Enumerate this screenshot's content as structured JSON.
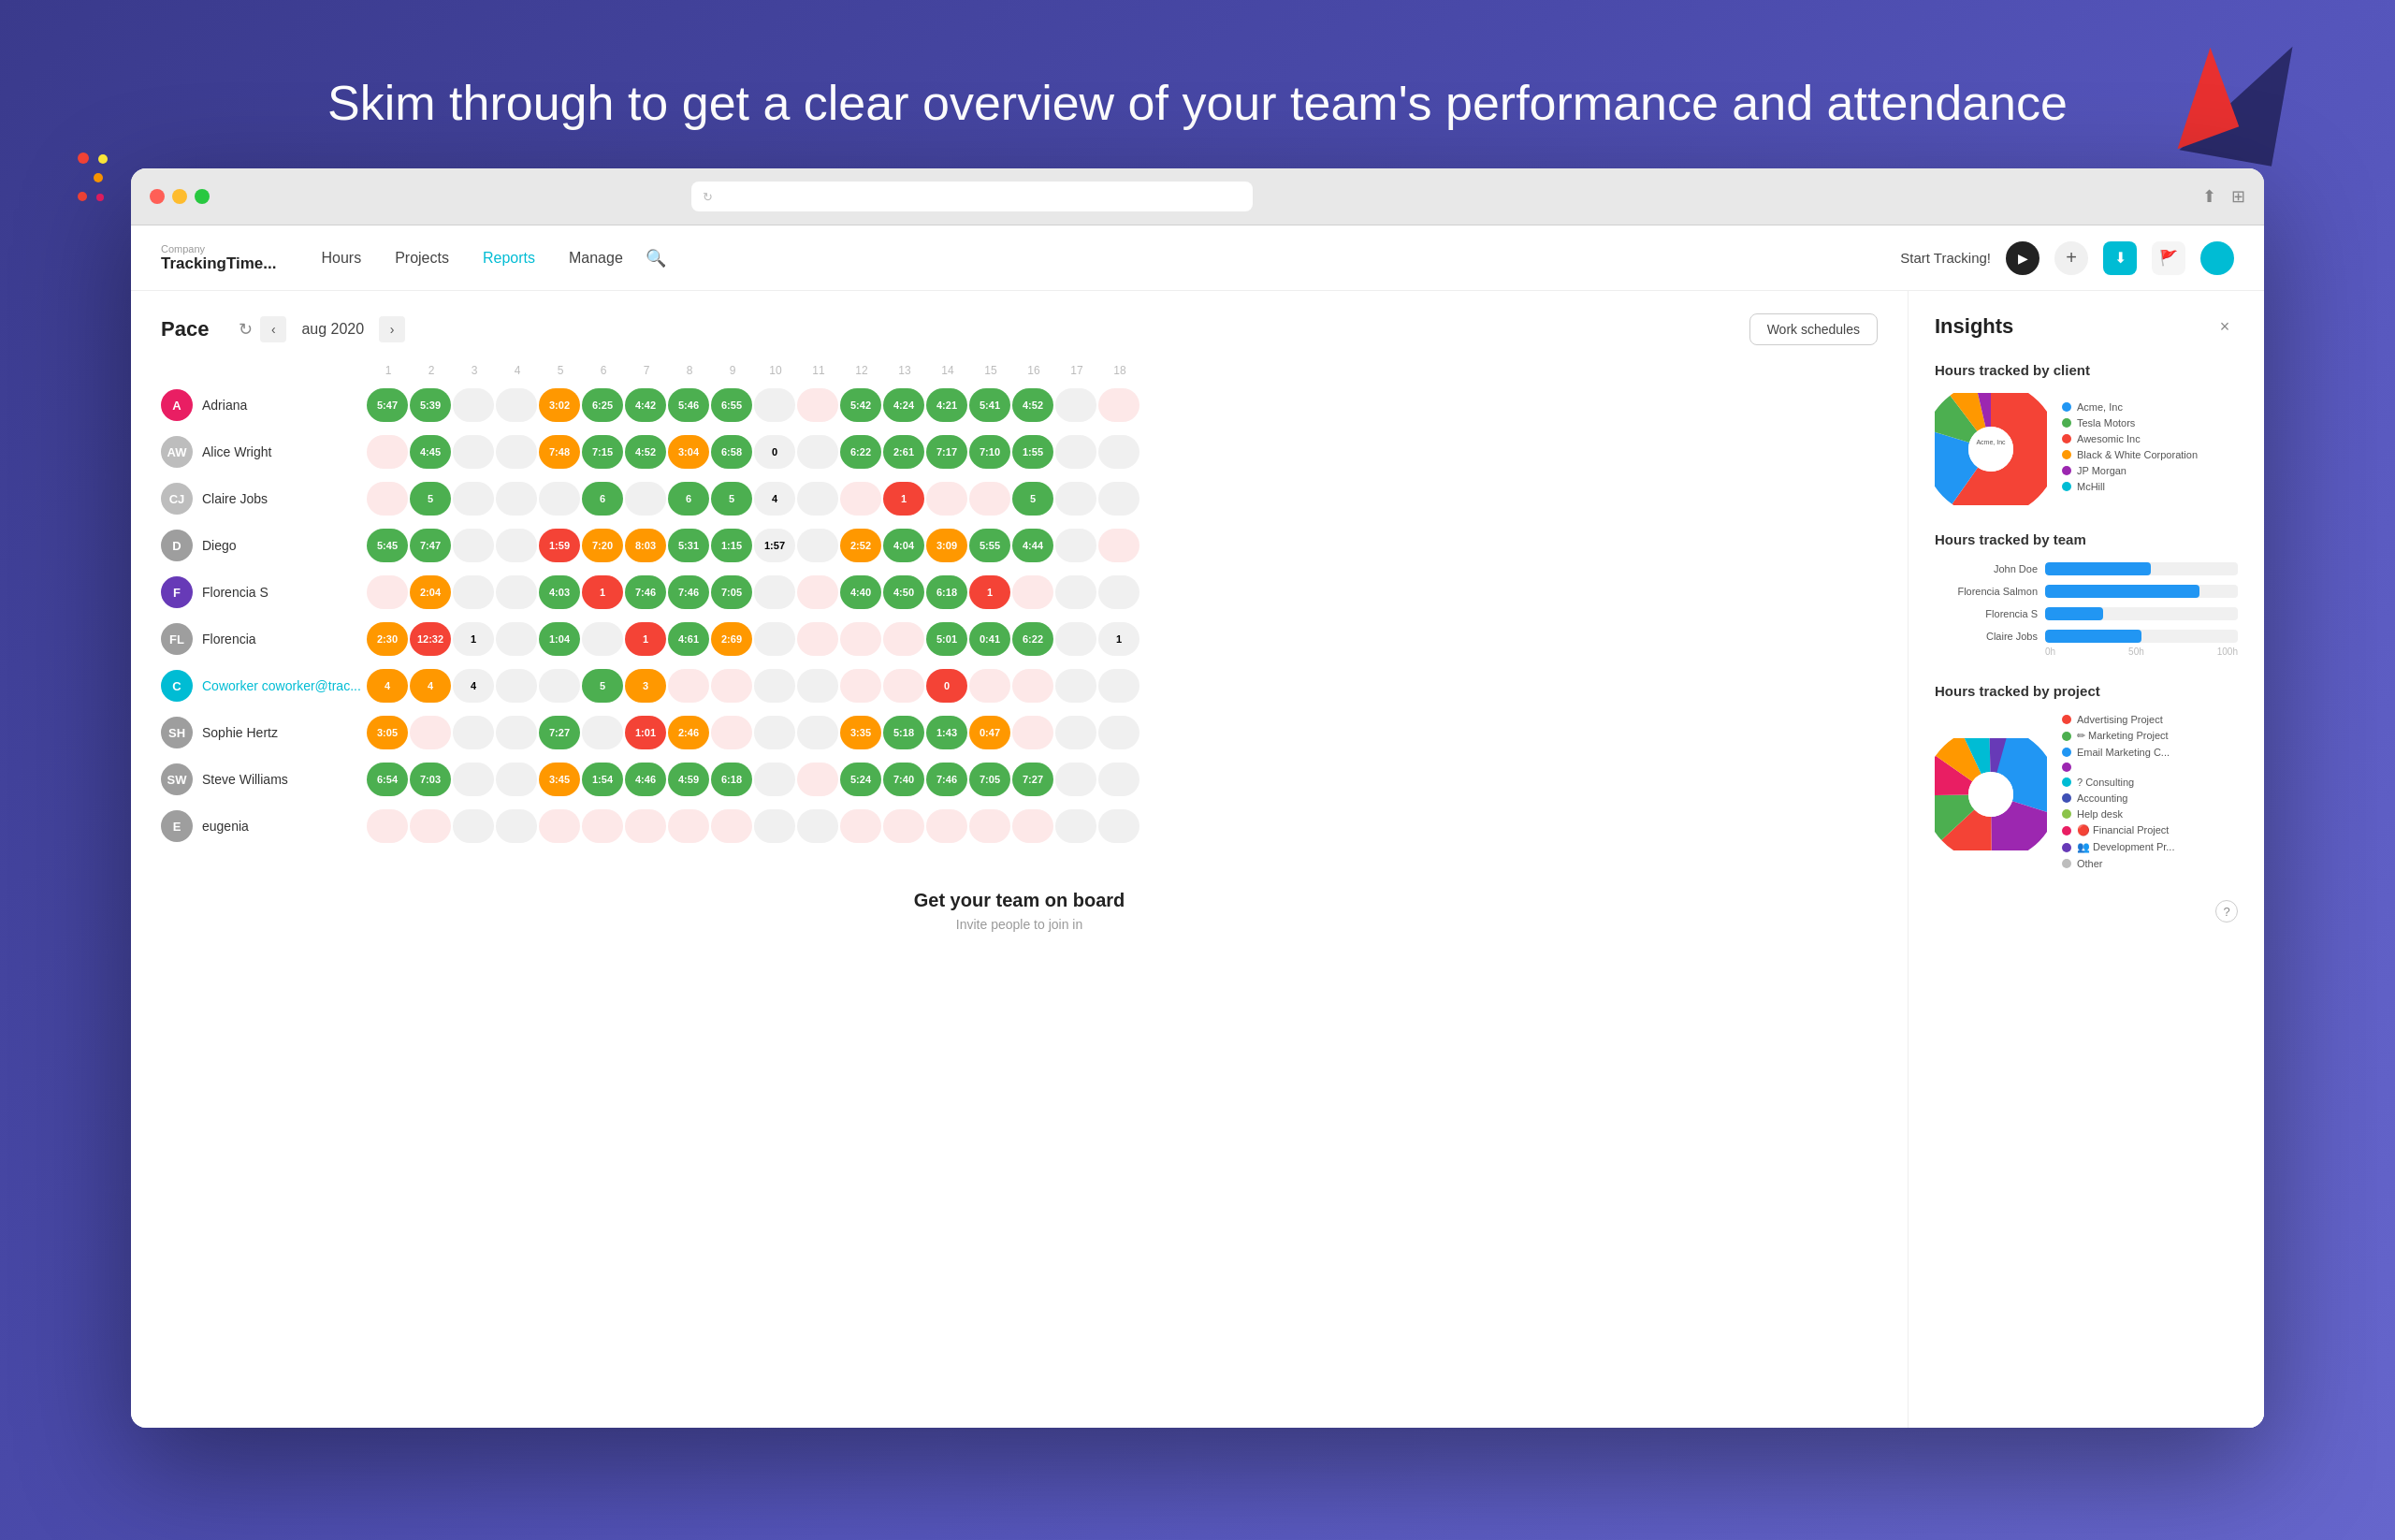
{
  "page": {
    "headline": "Skim through to get a clear overview of your team's performance and attendance"
  },
  "browser": {
    "url": ""
  },
  "navbar": {
    "brand_label": "Company",
    "brand_name": "TrackingTime...",
    "links": [
      "Hours",
      "Projects",
      "Reports",
      "Manage"
    ],
    "active_link": "Reports",
    "start_tracking": "Start Tracking!",
    "plus_label": "+",
    "search_label": "🔍"
  },
  "pace": {
    "title": "Pace",
    "month": "aug 2020",
    "work_schedules_btn": "Work schedules"
  },
  "calendar": {
    "days": [
      "1",
      "2",
      "3",
      "4",
      "5",
      "6",
      "7",
      "8",
      "9",
      "10",
      "11",
      "12",
      "13",
      "14",
      "15",
      "16",
      "17",
      "18"
    ],
    "users": [
      {
        "name": "Adriana",
        "avatar_color": "#e91e63",
        "initials": "A",
        "avatar_img": true
      },
      {
        "name": "Alice Wright",
        "avatar_color": "#9e9e9e",
        "initials": "AW",
        "avatar_img": true
      },
      {
        "name": "Claire Jobs",
        "avatar_color": "#9e9e9e",
        "initials": "CJ",
        "avatar_img": true
      },
      {
        "name": "Diego",
        "avatar_color": "#9e9e9e",
        "initials": "D",
        "avatar_img": true
      },
      {
        "name": "Florencia S",
        "avatar_color": "#673ab7",
        "initials": "F",
        "is_initial": true
      },
      {
        "name": "Florencia",
        "avatar_color": "#9e9e9e",
        "initials": "FL",
        "avatar_img": true
      },
      {
        "name": "Coworker coworker@trac...",
        "avatar_color": "#00bcd4",
        "initials": "C",
        "is_teal_name": true,
        "avatar_img": true
      },
      {
        "name": "Sophie Hertz",
        "avatar_color": "#9e9e9e",
        "initials": "SH",
        "avatar_img": true
      },
      {
        "name": "Steve Williams",
        "avatar_color": "#9e9e9e",
        "initials": "SW",
        "avatar_img": true
      },
      {
        "name": "eugenia",
        "avatar_color": "#9e9e9e",
        "initials": "E",
        "avatar_img": true
      }
    ]
  },
  "invite": {
    "title": "Get your team on board",
    "subtitle": "Invite people to join in"
  },
  "insights": {
    "title": "Insights",
    "close_btn": "×",
    "hours_by_client_title": "Hours tracked by client",
    "hours_by_team_title": "Hours tracked by team",
    "hours_by_project_title": "Hours tracked by project",
    "client_legend": [
      {
        "label": "Acme, Inc",
        "color": "#2196f3"
      },
      {
        "label": "Tesla Motors",
        "color": "#4caf50"
      },
      {
        "label": "Awesomic Inc",
        "color": "#f44336"
      },
      {
        "label": "Black & White Corporation",
        "color": "#ff9800"
      },
      {
        "label": "JP Morgan",
        "color": "#9c27b0"
      },
      {
        "label": "McHill",
        "color": "#00bcd4"
      }
    ],
    "acme_label": "Acme, Inc",
    "team_bars": [
      {
        "label": "John Doe",
        "pct": 55,
        "color": "#2196f3"
      },
      {
        "label": "Florencia Salmon",
        "pct": 80,
        "color": "#2196f3"
      },
      {
        "label": "Florencia S",
        "pct": 30,
        "color": "#2196f3"
      },
      {
        "label": "Claire Jobs",
        "pct": 50,
        "color": "#2196f3"
      }
    ],
    "bar_axis_labels": [
      "0h",
      "50h",
      "100h"
    ],
    "project_legend": [
      {
        "label": "Advertising Project",
        "color": "#f44336"
      },
      {
        "label": "✏ Marketing Project",
        "color": "#4caf50"
      },
      {
        "label": "Email Marketing C...",
        "color": "#2196f3"
      },
      {
        "label": "",
        "color": "#9c27b0"
      },
      {
        "label": "? Consulting",
        "color": "#00bcd4"
      },
      {
        "label": "Accounting",
        "color": "#3f51b5"
      },
      {
        "label": "Help desk",
        "color": "#8bc34a"
      },
      {
        "label": "🔴 Financial Project",
        "color": "#e91e63"
      },
      {
        "label": "👥 Development Pr...",
        "color": "#673ab7"
      },
      {
        "label": "Other",
        "color": "#bdbdbd"
      }
    ]
  }
}
